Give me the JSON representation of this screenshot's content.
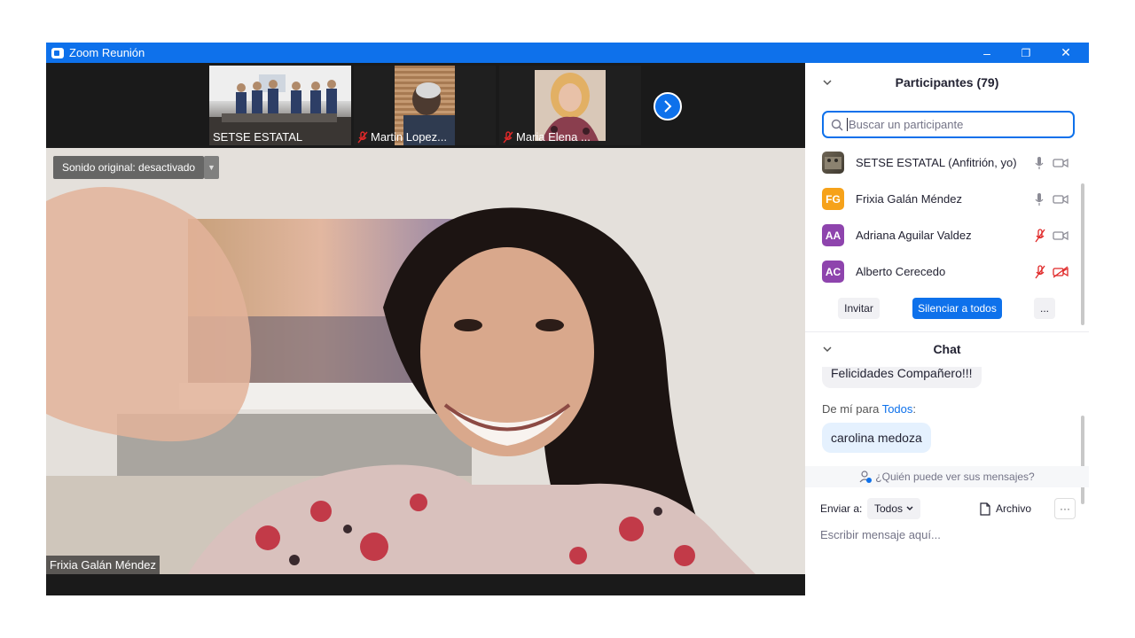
{
  "window": {
    "title": "Zoom Reunión",
    "controls": {
      "minimize": "–",
      "restore": "❐",
      "close": "✕"
    }
  },
  "video_strip": {
    "thumbnails": [
      {
        "label": "SETSE ESTATAL",
        "muted": false
      },
      {
        "label": "Martin Lopez...",
        "muted": true
      },
      {
        "label": "Maria Elena ...",
        "muted": true
      }
    ],
    "next_icon": "chevron-right-icon"
  },
  "main_video": {
    "sound_label": "Sonido original: desactivado",
    "speaker_name": "Frixia Galán Méndez"
  },
  "participants": {
    "title": "Participantes (79)",
    "search_placeholder": "Buscar un participante",
    "list": [
      {
        "initials": "",
        "name": "SETSE ESTATAL (Anfitrión, yo)",
        "color": "#5a5040",
        "mic": "on",
        "cam": "on"
      },
      {
        "initials": "FG",
        "name": "Frixia Galán Méndez",
        "color": "#f6a21a",
        "mic": "on",
        "cam": "on"
      },
      {
        "initials": "AA",
        "name": "Adriana Aguilar Valdez",
        "color": "#8e44ad",
        "mic": "muted",
        "cam": "on"
      },
      {
        "initials": "AC",
        "name": "Alberto Cerecedo",
        "color": "#8e44ad",
        "mic": "muted",
        "cam": "off"
      }
    ],
    "invite_label": "Invitar",
    "mute_all_label": "Silenciar a todos",
    "more_label": "..."
  },
  "chat": {
    "title": "Chat",
    "prev_message": "Felicidades Compañero!!!",
    "from_prefix": "De mí para",
    "from_to": "Todos",
    "from_suffix": ":",
    "last_message": "carolina medoza",
    "who_can_see": "¿Quién puede ver sus mensajes?",
    "send_to_label": "Enviar a:",
    "send_to_value": "Todos",
    "file_label": "Archivo",
    "more_label": "···",
    "input_placeholder": "Escribir mensaje aquí..."
  },
  "colors": {
    "accent": "#0e71eb",
    "muted_red": "#e02828",
    "bubble": "#e5f1fe"
  }
}
